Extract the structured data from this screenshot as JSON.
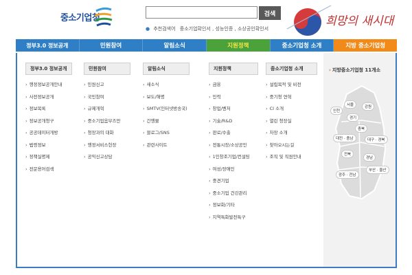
{
  "header": {
    "logo_text": "중소기업청",
    "search": {
      "placeholder": "",
      "button": "검색"
    },
    "recommend_prefix": "추천검색어",
    "recommend_terms": "중소기업확인서 , 성능인증 , 소상공인확인서",
    "slogan": "희망의 새시대"
  },
  "colors": {
    "nav_blue": "#2f7fc7",
    "nav_green": "#4ba23a",
    "nav_orange": "#f28a19",
    "panel_border": "#3b7bc1"
  },
  "nav": {
    "items": [
      {
        "label": "정부3.0 정보공개"
      },
      {
        "label": "민원참여"
      },
      {
        "label": "알림소식"
      },
      {
        "label": "지원정책"
      },
      {
        "label": "중소기업청 소개"
      },
      {
        "label": "지방 중소기업청"
      }
    ]
  },
  "columns": [
    {
      "title": "정부3.0 정보공개",
      "items": [
        "행정정보공개안내",
        "사전정보공개",
        "정보목록",
        "정보공개청구",
        "공공데이터개방",
        "법령정보",
        "정책실명제",
        "전문용어검색"
      ]
    },
    {
      "title": "민원참여",
      "items": [
        "민원신고",
        "국민참여",
        "규제개혁",
        "중소기업옴부즈만",
        "청장과의 대화",
        "행정서비스헌장",
        "공익신고상담"
      ]
    },
    {
      "title": "알림소식",
      "items": [
        "새소식",
        "보도/해명",
        "SMTV(인터넷방송국)",
        "간행물",
        "블로그/SNS",
        "관련사이트"
      ]
    },
    {
      "title": "지원정책",
      "items": [
        "금융",
        "인력",
        "창업/벤처",
        "기술/R&D",
        "판로/수출",
        "전통시장/소상공인",
        "1인창조기업/컨설팅",
        "여성/장애인",
        "중견기업",
        "중소기업 건강관리",
        "정보화/기타",
        "지역특화발전특구"
      ]
    },
    {
      "title": "중소기업청 소개",
      "items": [
        "설립목적 및 비전",
        "중기청 연혁",
        "CI 소개",
        "열린 청장실",
        "차장 소개",
        "찾아오시는길",
        "조직 및 직원안내"
      ]
    }
  ],
  "region": {
    "title": "지방중소기업청 11개소",
    "offices": [
      "서울",
      "강원",
      "인천",
      "경기",
      "충북",
      "대전 · 충남",
      "대구 · 경북",
      "전북",
      "경남",
      "부산 · 울산",
      "광주 · 전남"
    ]
  }
}
